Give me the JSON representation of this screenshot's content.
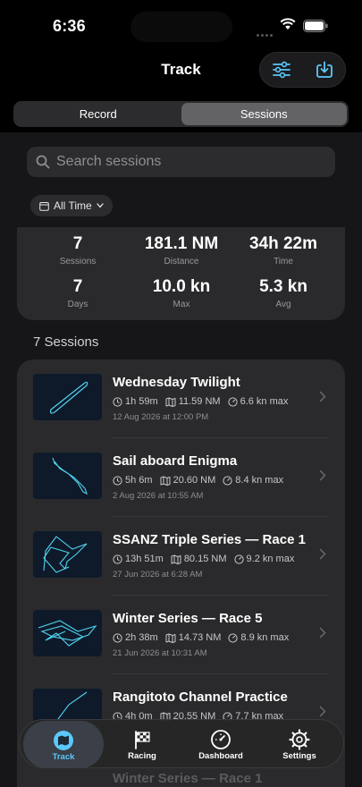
{
  "status_bar": {
    "time": "6:36"
  },
  "nav": {
    "title": "Track"
  },
  "segments": [
    {
      "label": "Record",
      "active": false
    },
    {
      "label": "Sessions",
      "active": true
    }
  ],
  "search": {
    "placeholder": "Search sessions",
    "value": ""
  },
  "filter": {
    "label": "All Time"
  },
  "stats": [
    {
      "value": "7",
      "label": "Sessions"
    },
    {
      "value": "181.1 NM",
      "label": "Distance"
    },
    {
      "value": "34h 22m",
      "label": "Time"
    },
    {
      "value": "7",
      "label": "Days"
    },
    {
      "value": "10.0 kn",
      "label": "Max"
    },
    {
      "value": "5.3 kn",
      "label": "Avg"
    }
  ],
  "list_heading": "7 Sessions",
  "sessions": [
    {
      "title": "Wednesday Twilight",
      "duration": "1h 59m",
      "distance": "11.59 NM",
      "speed": "6.6 kn max",
      "date": "12 Aug 2026 at 12:00 PM"
    },
    {
      "title": "Sail aboard Enigma",
      "duration": "5h 6m",
      "distance": "20.60 NM",
      "speed": "8.4 kn max",
      "date": "2 Aug 2026 at 10:55 AM"
    },
    {
      "title": "SSANZ Triple Series — Race 1",
      "duration": "13h 51m",
      "distance": "80.15 NM",
      "speed": "9.2 kn max",
      "date": "27 Jun 2026 at 6:28 AM"
    },
    {
      "title": "Winter Series — Race 5",
      "duration": "2h 38m",
      "distance": "14.73 NM",
      "speed": "8.9 kn max",
      "date": "21 Jun 2026 at 10:31 AM"
    },
    {
      "title": "Rangitoto Channel Practice",
      "duration": "4h 0m",
      "distance": "20.55 NM",
      "speed": "7.7 kn max",
      "date": ""
    }
  ],
  "peek_title": "Winter Series — Race 1",
  "tabs": [
    {
      "label": "Track",
      "icon": "map-icon",
      "active": true
    },
    {
      "label": "Racing",
      "icon": "checkered-flag-icon",
      "active": false
    },
    {
      "label": "Dashboard",
      "icon": "gauge-icon",
      "active": false
    },
    {
      "label": "Settings",
      "icon": "gear-icon",
      "active": false
    }
  ],
  "colors": {
    "accent": "#5ac8fa",
    "track_line": "#4fd4f0",
    "background": "#000000",
    "card": "#2a2a2c"
  }
}
